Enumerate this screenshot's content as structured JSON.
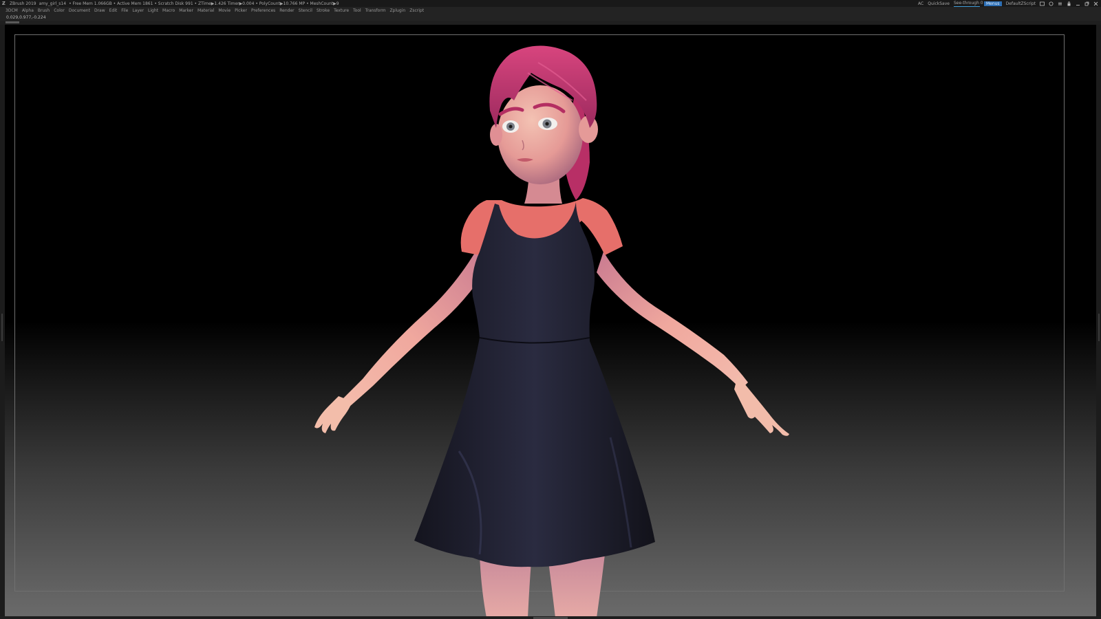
{
  "title_bar": {
    "app_title": "ZBrush 2019",
    "document_name": "amy_girl_s14",
    "stats": "• Free Mem 1.066GB • Active Mem 1861 • Scratch Disk 991 •  ZTime▶1.426 Timer▶0.004 • PolyCount▶10.766 MP  • MeshCount▶9",
    "ac_label": "AC",
    "quicksave_label": "QuickSave",
    "see_through_label": "See-through   0",
    "menus_label": "Menus",
    "default_script": "DefaultZScript"
  },
  "menu": {
    "items": [
      "3DCM",
      "Alpha",
      "Brush",
      "Color",
      "Document",
      "Draw",
      "Edit",
      "File",
      "Layer",
      "Light",
      "Macro",
      "Marker",
      "Material",
      "Movie",
      "Picker",
      "Preferences",
      "Render",
      "Stencil",
      "Stroke",
      "Texture",
      "Tool",
      "Transform",
      "Zplugin",
      "Zscript"
    ]
  },
  "status": {
    "coordinates": "0.029,0.977,-0.224"
  },
  "colors": {
    "accent": "#2d6fb5",
    "hair": "#c23a72",
    "skin": "#e8a6a0",
    "shirt": "#e8706a",
    "dress": "#1c1d2c"
  },
  "icons": [
    "zbrush-logo-icon",
    "layout-icon",
    "palette-icon",
    "script-icon",
    "lock-icon",
    "minimize-icon",
    "restore-icon",
    "close-icon"
  ]
}
